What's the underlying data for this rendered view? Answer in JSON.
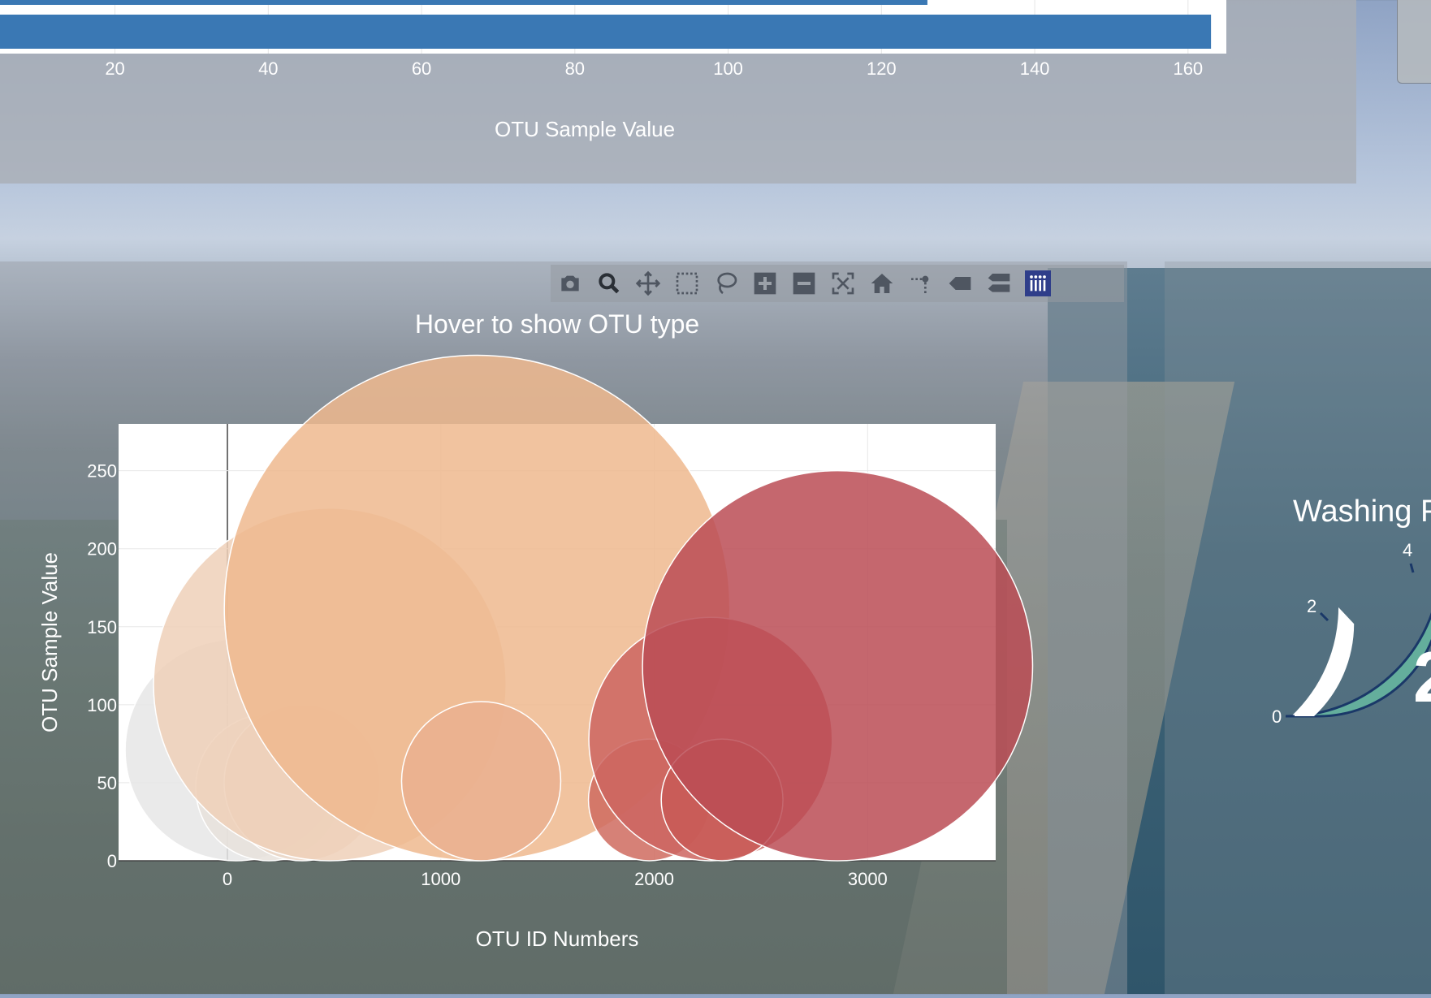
{
  "bar_chart": {
    "xlabel": "OTU Sample Value",
    "ticks": [
      20,
      40,
      60,
      80,
      100,
      120,
      140,
      160
    ],
    "visible_bars": [
      126,
      163
    ]
  },
  "bubble_chart": {
    "title": "Hover to show OTU type",
    "xlabel": "OTU ID Numbers",
    "ylabel": "OTU Sample Value",
    "colorscale": [
      "#e6e6e6",
      "#efd0b8",
      "#eeb98e",
      "#d06a62",
      "#bb4c55"
    ]
  },
  "gauge": {
    "title": "Washing F",
    "ticks": [
      "0",
      "2",
      "4"
    ],
    "value_text": "2",
    "colors": {
      "band": "#64ae9c",
      "outline": "#1a3868",
      "fill": "#ffffff"
    }
  },
  "modebar": {
    "buttons": [
      {
        "name": "camera-icon"
      },
      {
        "name": "zoom-icon"
      },
      {
        "name": "pan-icon"
      },
      {
        "name": "box-select-icon"
      },
      {
        "name": "lasso-select-icon"
      },
      {
        "name": "zoom-in-icon"
      },
      {
        "name": "zoom-out-icon"
      },
      {
        "name": "autoscale-icon"
      },
      {
        "name": "reset-axes-icon"
      },
      {
        "name": "toggle-spike-lines-icon"
      },
      {
        "name": "hover-closest-icon"
      },
      {
        "name": "hover-compare-icon"
      },
      {
        "name": "plotly-logo-icon"
      }
    ]
  },
  "chart_data": [
    {
      "type": "bar",
      "orientation": "horizontal",
      "values": [
        126,
        163
      ],
      "xlabel": "OTU Sample Value",
      "xlim": [
        5,
        165
      ],
      "grid": true
    },
    {
      "type": "scatter",
      "title": "Hover to show OTU type",
      "xlabel": "OTU ID Numbers",
      "ylabel": "OTU Sample Value",
      "xlim": [
        -510,
        3600
      ],
      "ylim": [
        0,
        280
      ],
      "xticks": [
        0,
        1000,
        2000,
        3000
      ],
      "yticks": [
        0,
        50,
        100,
        150,
        200,
        250
      ],
      "points": [
        {
          "x": 40,
          "y": 71,
          "size": 71,
          "color": "#e6e6e6"
        },
        {
          "x": 195,
          "y": 47,
          "size": 47,
          "color": "#e8e2dc"
        },
        {
          "x": 350,
          "y": 50,
          "size": 50,
          "color": "#ebd6c6"
        },
        {
          "x": 480,
          "y": 113,
          "size": 113,
          "color": "#efd0b8"
        },
        {
          "x": 1170,
          "y": 162,
          "size": 162,
          "color": "#eeb98e"
        },
        {
          "x": 1189,
          "y": 51,
          "size": 51,
          "color": "#eab08f"
        },
        {
          "x": 1977,
          "y": 39,
          "size": 39,
          "color": "#cf6b5f"
        },
        {
          "x": 2264,
          "y": 78,
          "size": 78,
          "color": "#cc6560"
        },
        {
          "x": 2318,
          "y": 39,
          "size": 39,
          "color": "#c85a56"
        },
        {
          "x": 2859,
          "y": 125,
          "size": 125,
          "color": "#bb4c55"
        }
      ]
    }
  ]
}
